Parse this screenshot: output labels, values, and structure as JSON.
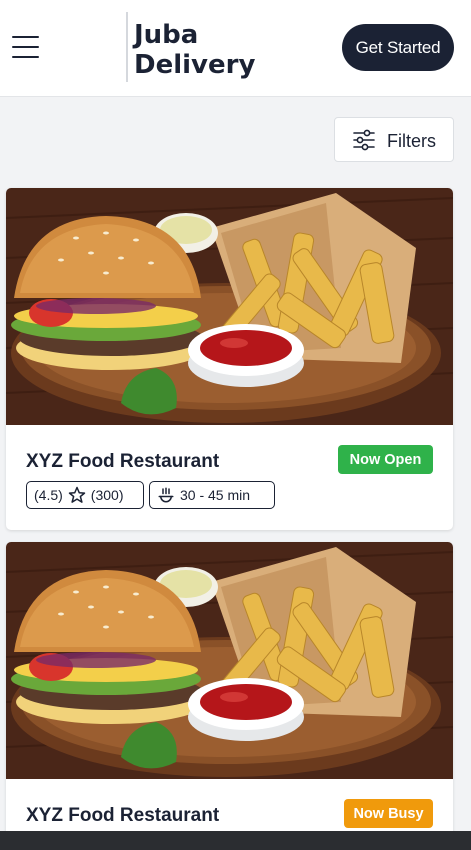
{
  "header": {
    "brand_line1": "Juba",
    "brand_line2": "Delivery",
    "cta_label": "Get Started",
    "menu_icon": "hamburger-menu-icon"
  },
  "toolbar": {
    "filters_label": "Filters",
    "filters_icon": "sliders-icon"
  },
  "restaurants": [
    {
      "name": "XYZ Food Restaurant",
      "status": "Now Open",
      "status_color": "#2fb24a",
      "rating": "(4.5)",
      "reviews": "(300)",
      "delivery_time": "30 - 45 min",
      "image": "burger-and-fries-photo"
    },
    {
      "name": "XYZ Food Restaurant",
      "status": "Now Busy",
      "status_color": "#f09a0c",
      "image": "burger-and-fries-photo"
    }
  ],
  "colors": {
    "primary": "#1b2234",
    "background": "#f2f3f5",
    "open": "#2fb24a",
    "busy": "#f09a0c"
  }
}
